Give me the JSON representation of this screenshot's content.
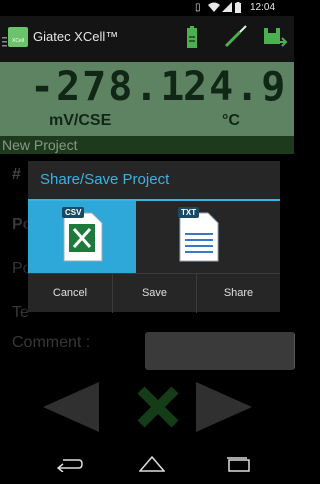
{
  "status_bar": {
    "time": "12:04"
  },
  "action_bar": {
    "app_title": "Giatec XCell™",
    "logo_text": "XCell"
  },
  "readings": {
    "potential_value": "-278.1",
    "potential_unit": "mV/CSE",
    "temperature_value": "24.9",
    "temperature_unit": "°C"
  },
  "project_bar": {
    "title": "New Project"
  },
  "form": {
    "label_number": "#",
    "label_p1": "Po",
    "label_p2": "Po",
    "label_t": "Te",
    "comment_label": "Comment :"
  },
  "dialog": {
    "title": "Share/Save Project",
    "csv_badge": "CSV",
    "txt_badge": "TXT",
    "buttons": {
      "cancel": "Cancel",
      "save": "Save",
      "share": "Share"
    }
  },
  "colors": {
    "accent": "#33b5e5",
    "reading_bg": "#8fc997",
    "project_bar": "#2d5a2d",
    "green_x": "#2e7d32"
  }
}
